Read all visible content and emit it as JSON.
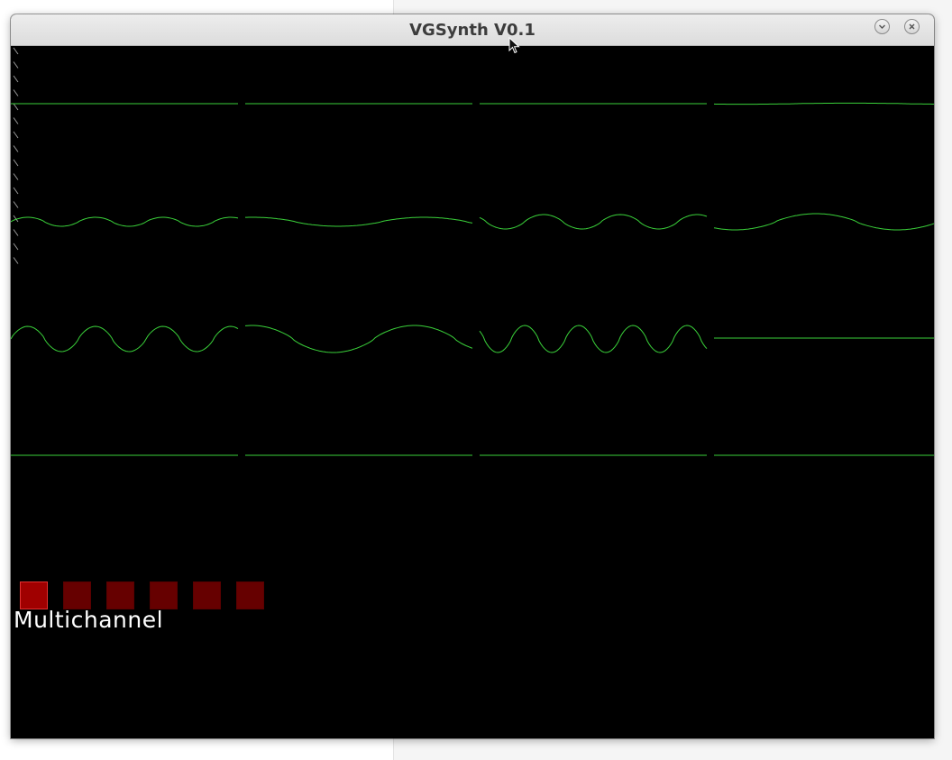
{
  "window": {
    "title": "VGSynth V0.1",
    "minimize_icon": "chevron-down-icon",
    "close_icon": "close-icon"
  },
  "colors": {
    "waveform": "#3ad13a",
    "background": "#000000",
    "channel_active": "#a00000",
    "channel_inactive": "#660000",
    "label_text": "#ffffff"
  },
  "channels": {
    "active_index": 0,
    "count": 6
  },
  "mode_label": "Multichannel"
}
